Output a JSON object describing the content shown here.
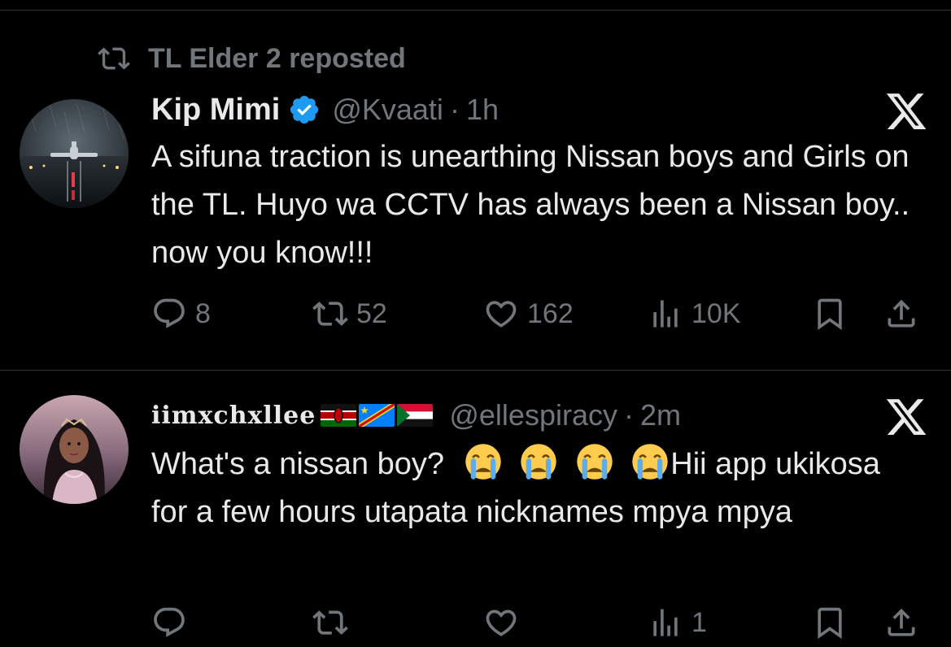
{
  "tweet1": {
    "repost_label": "TL Elder 2 reposted",
    "author_name": "Kip Mimi",
    "handle": "@Kvaati",
    "separator": "·",
    "time": "1h",
    "text": "A sifuna traction is unearthing Nissan boys and Girls on the TL. Huyo wa CCTV has always been a Nissan boy.. now you know!!!",
    "replies": "8",
    "reposts": "52",
    "likes": "162",
    "views": "10K"
  },
  "tweet2": {
    "author_name": "iimxchxllee",
    "handle": "@ellespiracy",
    "separator": "·",
    "time": "2m",
    "text_before": "What's a nissan boy?",
    "text_after": "Hii app ukikosa for a few hours utapata nicknames mpya mpya",
    "views": "1"
  },
  "colors": {
    "background": "#000000",
    "text": "#e7e9ea",
    "muted": "#71767b",
    "verified": "#1d9bf0",
    "divider": "#2f3336"
  },
  "icons": [
    "repost-icon",
    "verified-badge-icon",
    "x-logo-icon",
    "reply-icon",
    "retweet-icon",
    "like-icon",
    "views-icon",
    "bookmark-icon",
    "share-icon",
    "crying-face-emoji",
    "kenya-flag",
    "drc-flag",
    "sudan-flag"
  ]
}
